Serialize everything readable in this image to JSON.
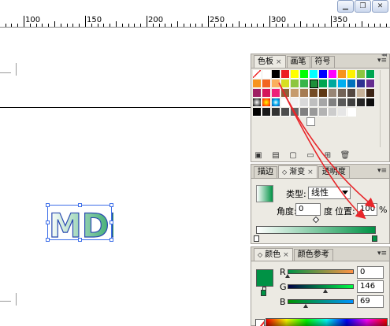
{
  "ruler": {
    "labels": [
      "100",
      "150",
      "200",
      "250",
      "300",
      "350"
    ]
  },
  "canvas": {
    "artwork_text": "MDL"
  },
  "swatches_panel": {
    "tabs": [
      {
        "label": "色板",
        "active": true
      },
      {
        "label": "画笔",
        "active": false
      },
      {
        "label": "符号",
        "active": false
      }
    ],
    "selected_color": "#1e8f3a"
  },
  "gradient_panel": {
    "tabs": [
      {
        "label": "描边",
        "active": false
      },
      {
        "label": "渐变",
        "active": true
      },
      {
        "label": "透明度",
        "active": false
      }
    ],
    "type_label": "类型:",
    "type_value": "线性",
    "angle_label": "角度:",
    "angle_value": "0",
    "angle_unit": "度",
    "position_label": "位置:",
    "position_value": "100",
    "position_unit": "%",
    "start_color": "#ffffff",
    "end_color": "#009245"
  },
  "color_panel": {
    "tabs": [
      {
        "label": "颜色",
        "active": true
      },
      {
        "label": "颜色参考",
        "active": false
      }
    ],
    "channels": [
      {
        "label": "R",
        "value": "0",
        "fraction": 0
      },
      {
        "label": "G",
        "value": "146",
        "fraction": 0.573
      },
      {
        "label": "B",
        "value": "69",
        "fraction": 0.271
      }
    ],
    "fill_color": "#009245"
  },
  "colors": {
    "annotation_arrow": "#e8262a",
    "selection": "#3d6ee8"
  }
}
